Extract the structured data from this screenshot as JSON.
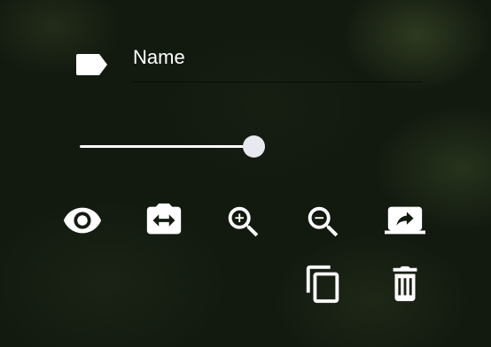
{
  "name_field": {
    "tag_icon": "label-tag-icon",
    "label": "Name"
  },
  "slider": {
    "value": 1.0
  },
  "toolbar": {
    "icons": [
      "eye-icon",
      "switch-camera-icon",
      "zoom-in-icon",
      "zoom-out-icon",
      "share-screen-icon",
      "copy-icon",
      "delete-icon"
    ]
  },
  "colors": {
    "foreground": "#ffffff",
    "slider_thumb": "#e7e9ee",
    "background": "#121a10"
  }
}
